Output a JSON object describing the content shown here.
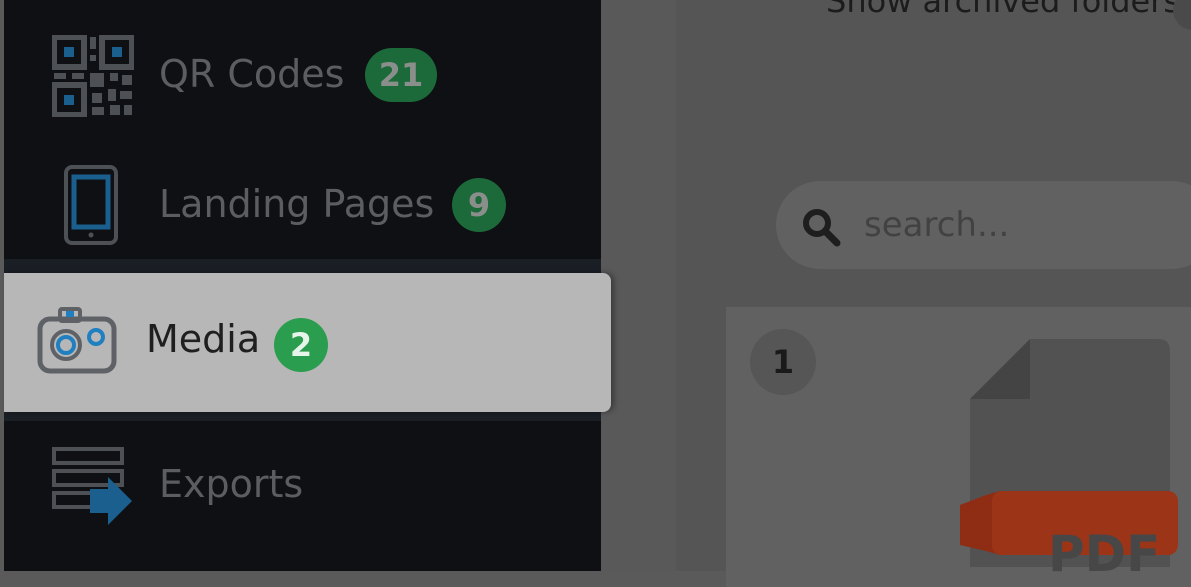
{
  "sidebar": {
    "items": [
      {
        "label": "QR Codes",
        "count": "21",
        "icon": "qr-code-icon"
      },
      {
        "label": "Landing Pages",
        "count": "9",
        "icon": "mobile-phone-icon"
      },
      {
        "label": "Media",
        "count": "2",
        "icon": "camera-icon",
        "active": true
      },
      {
        "label": "Exports",
        "count": "",
        "icon": "export-icon"
      }
    ]
  },
  "main": {
    "archived_toggle_label": "Show archived folders",
    "search": {
      "placeholder": "search...",
      "value": ""
    },
    "media_items": [
      {
        "number": "1",
        "file_type": "PDF",
        "icon": "pdf-file-icon"
      }
    ]
  },
  "colors": {
    "sidebar_bg": "#0e1014",
    "active_item_bg": "#b7b7b7",
    "badge_green": "#2a9d4f",
    "pdf_red": "#b23a1c",
    "icon_blue": "#1f7fc0"
  }
}
